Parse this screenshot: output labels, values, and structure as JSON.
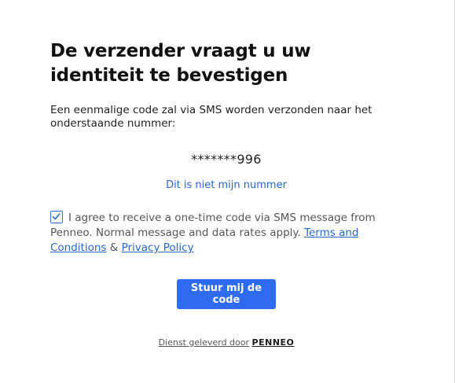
{
  "dialog": {
    "title": "De verzender vraagt u uw identiteit te bevestigen",
    "description": "Een eenmalige code zal via SMS worden verzonden naar het onderstaande nummer:",
    "masked_phone": "*******996",
    "not_my_number_link": "Dit is niet mijn nummer",
    "consent": {
      "checked": true,
      "text": "I agree to receive a one-time code via SMS message from Penneo. Normal message and data rates apply.",
      "terms_link": "Terms and Conditions",
      "separator": "&",
      "privacy_link": "Privacy Policy"
    },
    "send_button": "Stuur mij de code",
    "footer": {
      "label": "Dienst geleverd door",
      "brand": "PENNEO"
    }
  },
  "colors": {
    "accent": "#2e6bf0",
    "link": "#2a68c8"
  }
}
